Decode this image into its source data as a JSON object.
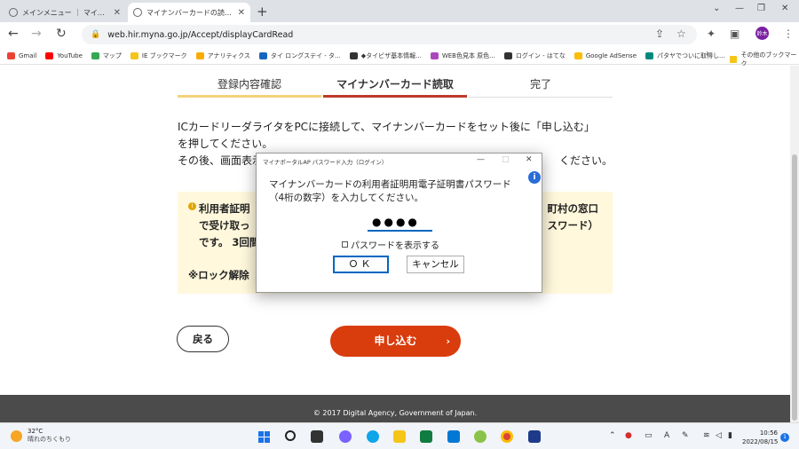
{
  "browser": {
    "tabs": [
      {
        "title": "メインメニュー ｜ マイナポータル",
        "active": false
      },
      {
        "title": "マイナンバーカードの読み取り ｜ マイ",
        "active": true
      }
    ],
    "new_tab_label": "+",
    "url": "web.hir.myna.go.jp/Accept/displayCardRead",
    "profile_initial": "鈴木",
    "bookmarks": [
      {
        "label": "Gmail",
        "color": "#ea4335"
      },
      {
        "label": "YouTube",
        "color": "#ff0000"
      },
      {
        "label": "マップ",
        "color": "#34a853"
      },
      {
        "label": "IE ブックマーク",
        "color": "#f5c518"
      },
      {
        "label": "アナリティクス",
        "color": "#f9ab00"
      },
      {
        "label": "タイ ロングステイ - タ...",
        "color": "#1565c0"
      },
      {
        "label": "◆タイビザ基本情報...",
        "color": "#333333"
      },
      {
        "label": "WEB色見本 原色...",
        "color": "#ab47bc"
      },
      {
        "label": "ログイン - はてな",
        "color": "#333333"
      },
      {
        "label": "Google AdSense",
        "color": "#fbbc04"
      },
      {
        "label": "パタヤでついに取得し...",
        "color": "#00897b"
      }
    ],
    "other_bookmarks": "その他のブックマーク"
  },
  "steps": [
    {
      "label": "登録内容確認"
    },
    {
      "label": "マイナンバーカード読取"
    },
    {
      "label": "完了"
    }
  ],
  "instructions": {
    "line1": "ICカードリーダライタをPCに接続して、マイナンバーカードをセット後に「申し込む」",
    "line2": "を押してください。",
    "line3": "その後、画面表示",
    "line3_end": "ください。"
  },
  "notice": {
    "line1_a": "利用者証明",
    "line1_b": "町村の窓口",
    "line2_a": "で受け取っ",
    "line2_b": "スワード）",
    "line3_a": "です。 3回間",
    "lock_text": "※ロック解除"
  },
  "buttons": {
    "back": "戻る",
    "apply": "申し込む"
  },
  "footer": {
    "copyright": "© 2017 Digital Agency, Government of Japan."
  },
  "dialog": {
    "title": "マイナポータルAP パスワード入力（ログイン）",
    "message_line1": "マイナンバーカードの利用者証明用電子証明書パスワード",
    "message_line2": "（4桁の数字）を入力してください。",
    "password_value": "●●●●",
    "show_password_label": "パスワードを表示する",
    "ok_label": "ＯＫ",
    "cancel_label": "キャンセル"
  },
  "taskbar": {
    "weather_temp": "32°C",
    "weather_desc": "晴れのちくもり",
    "ime": "A",
    "time": "10:56",
    "date": "2022/08/15",
    "notification_count": "1"
  },
  "colors": {
    "step_active": "#c0392b",
    "step_done": "#f3d27a",
    "apply_button": "#d93c0d",
    "notice_bg": "#fff8dc",
    "dialog_accent": "#0067c0"
  }
}
